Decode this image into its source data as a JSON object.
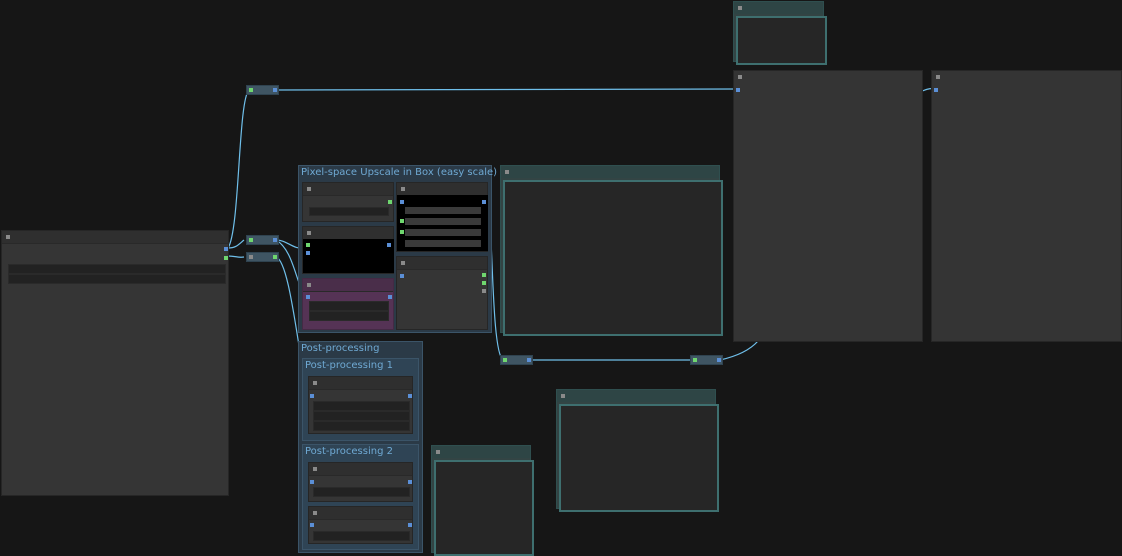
{
  "canvas": {
    "background": "#161616",
    "link_color": "#6fbfea"
  },
  "groups": {
    "upscale": {
      "title": "Pixel-space Upscale in Box (easy scale)"
    },
    "post_processing": {
      "title": "Post-processing"
    },
    "post_processing_1": {
      "title": "Post-processing 1"
    },
    "post_processing_2": {
      "title": "Post-processing 2"
    }
  },
  "colors": {
    "group_fill": "#2b3a47",
    "group_title": "#6fa9d3",
    "node_fill": "#353535",
    "preview_fill": "#334444",
    "purple_node": "#553355",
    "port_blue": "#5b8fd6",
    "port_green": "#6fd66f"
  }
}
